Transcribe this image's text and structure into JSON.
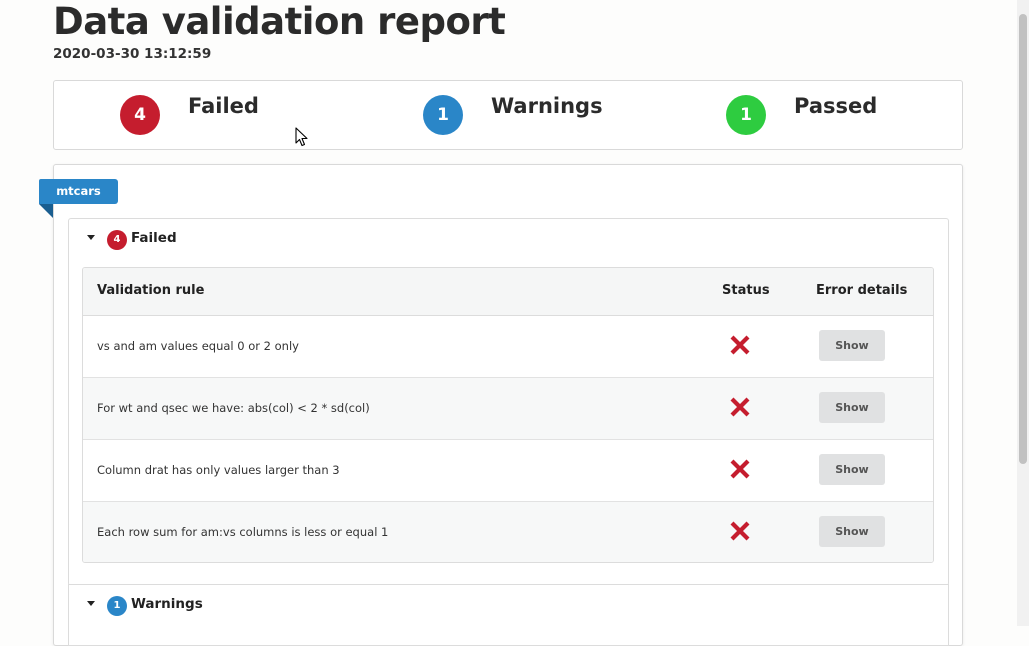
{
  "report": {
    "title": "Data validation report",
    "timestamp": "2020-03-30 13:12:59"
  },
  "summary": {
    "failed": {
      "count": "4",
      "label": "Failed",
      "color": "#c51d2e"
    },
    "warnings": {
      "count": "1",
      "label": "Warnings",
      "color": "#2a86c8"
    },
    "passed": {
      "count": "1",
      "label": "Passed",
      "color": "#2ecc40"
    }
  },
  "dataset": {
    "name": "mtcars"
  },
  "sections": {
    "failed": {
      "count": "4",
      "label": "Failed"
    },
    "warnings": {
      "count": "1",
      "label": "Warnings"
    }
  },
  "table": {
    "headers": {
      "rule": "Validation rule",
      "status": "Status",
      "details": "Error details"
    },
    "rows": [
      {
        "rule": "vs and am values equal 0 or 2 only",
        "status_icon": "cross-icon",
        "button": "Show"
      },
      {
        "rule": "For wt and qsec we have: abs(col) < 2 * sd(col)",
        "status_icon": "cross-icon",
        "button": "Show"
      },
      {
        "rule": "Column drat has only values larger than 3",
        "status_icon": "cross-icon",
        "button": "Show"
      },
      {
        "rule": "Each row sum for am:vs columns is less or equal 1",
        "status_icon": "cross-icon",
        "button": "Show"
      }
    ]
  },
  "icons": {
    "fail": "cross-icon",
    "pointer": "mouse-cursor-icon",
    "toggle": "caret-down-icon"
  }
}
